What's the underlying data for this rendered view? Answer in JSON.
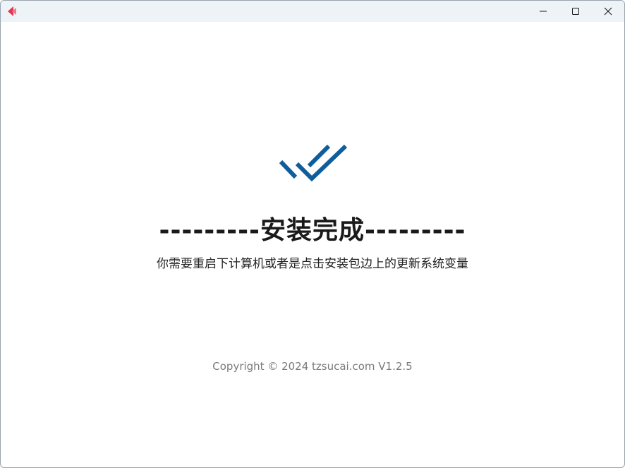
{
  "window": {
    "controls": {
      "minimize": "minimize-icon",
      "maximize": "maximize-icon",
      "close": "close-icon"
    }
  },
  "app_icon": "app-logo-icon",
  "status_icon": "double-check-icon",
  "main": {
    "title": "---------安装完成---------",
    "message": "你需要重启下计算机或者是点击安装包边上的更新系统变量",
    "copyright": "Copyright © 2024 tzsucai.com V1.2.5"
  },
  "colors": {
    "accent": "#0f5e9c",
    "logo_red": "#e8344e",
    "logo_pink": "#f37a8e"
  }
}
